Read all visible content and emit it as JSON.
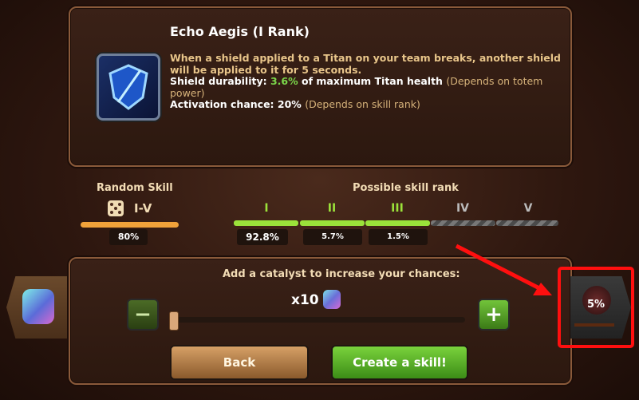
{
  "skill": {
    "title": "Echo Aegis (I Rank)",
    "description": "When a shield applied to a Titan on your team breaks, another shield will be applied to it for 5 seconds.",
    "durability_label": "Shield durability:",
    "durability_value": "3.6%",
    "durability_suffix": "of maximum Titan health",
    "durability_note": "(Depends on totem power)",
    "activation_label": "Activation chance: 20%",
    "activation_note": "(Depends on skill rank)",
    "icon": "shield-icon"
  },
  "random": {
    "label": "Random Skill",
    "rank_range": "I-V",
    "percent": "80%",
    "icon": "dice-icon"
  },
  "possible": {
    "label": "Possible skill rank",
    "ranks": [
      {
        "label": "I",
        "percent": "92.8%",
        "active": true
      },
      {
        "label": "II",
        "percent": "5.7%",
        "active": true
      },
      {
        "label": "III",
        "percent": "1.5%",
        "active": true
      },
      {
        "label": "IV",
        "active": false
      },
      {
        "label": "V",
        "active": false
      }
    ]
  },
  "catalyst": {
    "prompt": "Add a catalyst to increase your chances:",
    "count": "x10",
    "slider_fraction": 0.0
  },
  "buttons": {
    "back": "Back",
    "create": "Create a skill!",
    "minus": "−",
    "plus": "+"
  },
  "side": {
    "right_percent": "5%"
  },
  "colors": {
    "accent_green": "#7cd64a",
    "highlight_red": "#ff0f0f"
  }
}
